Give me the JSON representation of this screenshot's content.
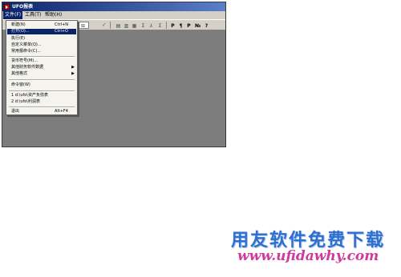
{
  "window": {
    "title": "UFO报表"
  },
  "menubar": [
    {
      "label": "文件(F)"
    },
    {
      "label": "工具(T)"
    },
    {
      "label": "帮助(H)"
    }
  ],
  "toolbar": {
    "confirm_glyph": "✓",
    "buttons": [
      "⊞",
      "▤",
      "▥",
      "▦",
      "Σ",
      "⅄",
      "Σ",
      "P",
      "¶",
      "P",
      "№",
      "?"
    ]
  },
  "file_menu": {
    "items": [
      {
        "label": "新建(N)",
        "shortcut": "Ctrl+N"
      },
      {
        "label": "打开(O)...",
        "shortcut": "Ctrl+O",
        "highlighted": true
      },
      {
        "label": "执行(E)"
      },
      {
        "label": "自定义菜单(Q)..."
      },
      {
        "label": "常用报命令(C)..."
      },
      {
        "label": "货币符号(M)..."
      },
      {
        "label": "其他财务软件数据",
        "submenu": true
      },
      {
        "label": "其他格式",
        "submenu": true
      },
      {
        "label": "命令窗(W)"
      },
      {
        "label": "1 d:\\ufo\\资产负债表"
      },
      {
        "label": "2 d:\\ufo\\利润表"
      },
      {
        "label": "退出",
        "shortcut": "Alt+F4"
      }
    ]
  },
  "watermark": {
    "title": "用友软件免费下载",
    "url": "www.ufidawhy.com"
  },
  "colors": {
    "titlebar": "#0a246a",
    "workspace": "#7d7d7d",
    "watermark_blue": "#2f6fd0",
    "watermark_pink": "#d03a9a"
  }
}
